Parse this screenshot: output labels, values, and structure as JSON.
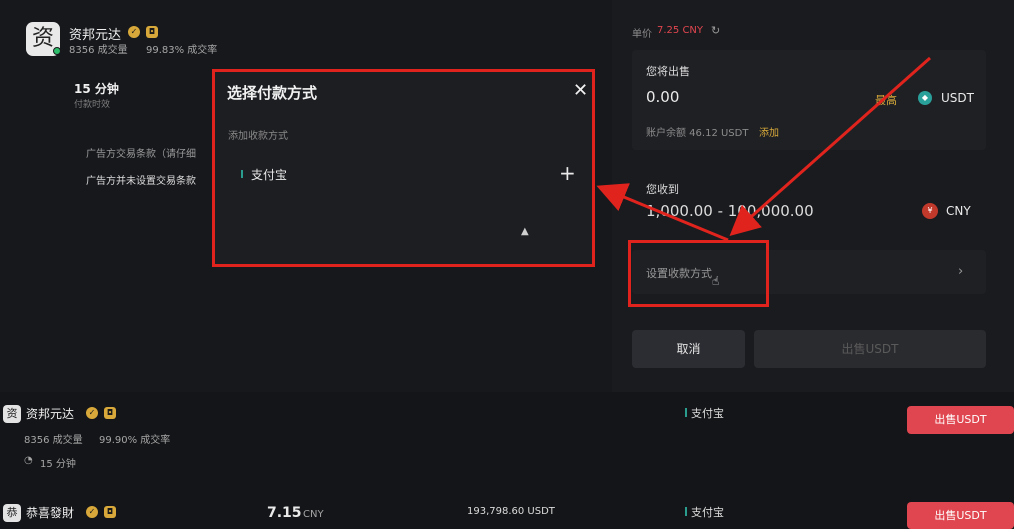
{
  "merchant": {
    "name": "资邦元达",
    "avatar_char": "资",
    "trades": "8356 成交量",
    "rate": "99.83% 成交率",
    "pay_time": "15 分钟",
    "pay_time_label": "付款时效",
    "terms_title": "广告方交易条款（请仔细",
    "terms_text": "广告方并未设置交易条款"
  },
  "modal": {
    "title": "选择付款方式",
    "close_icon": "close-icon",
    "add_label": "添加收款方式",
    "method": "支付宝"
  },
  "order": {
    "unit_price_label": "单价",
    "unit_price": "7.25 CNY",
    "sell_label": "您将出售",
    "sell_value": "0.00",
    "max_label": "最高",
    "sell_currency": "USDT",
    "balance": "账户余额 46.12 USDT",
    "balance_add": "添加",
    "receive_label": "您收到",
    "receive_value": "1,000.00 - 100,000.00",
    "receive_currency": "CNY",
    "set_payment": "设置收款方式",
    "cancel_label": "取消",
    "sell_button": "出售USDT",
    "colors": {
      "accent_red": "#e0241d",
      "price_red": "#e0464f",
      "highlight_orange": "#d8a93a",
      "usdt_teal": "#2aa09a"
    }
  },
  "rows": [
    {
      "avatar_char": "资",
      "name": "资邦元达",
      "trades": "8356 成交量",
      "rate": "99.90% 成交率",
      "time": "15 分钟",
      "payment": "支付宝",
      "sell_button": "出售USDT"
    },
    {
      "avatar_char": "恭",
      "name": "恭喜發財",
      "price": "7.15",
      "price_unit": "CNY",
      "amount": "193,798.60 USDT",
      "payment": "支付宝",
      "sell_button": "出售USDT"
    }
  ]
}
